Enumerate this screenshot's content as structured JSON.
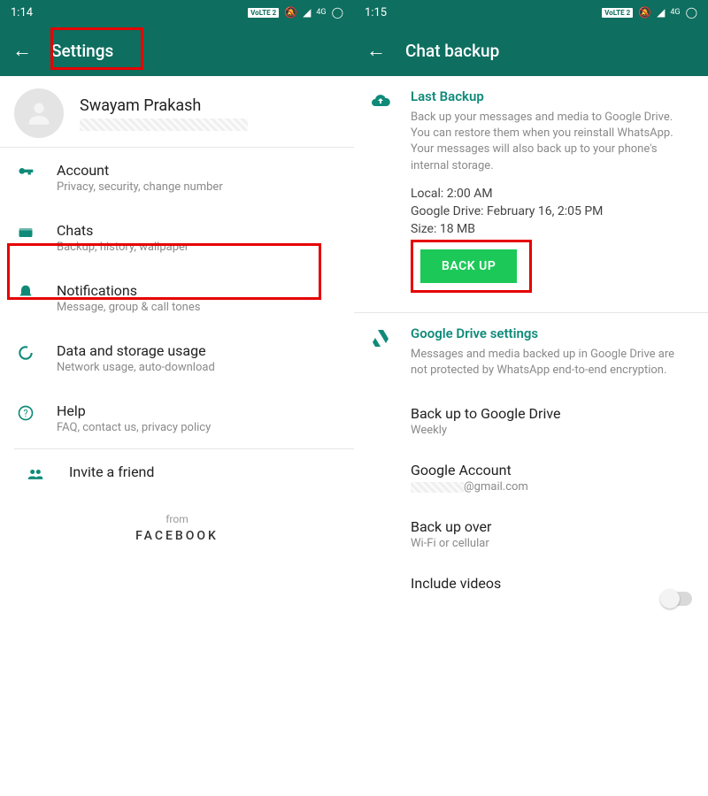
{
  "left": {
    "time": "1:14",
    "volte": "VoLTE 2",
    "title": "Settings",
    "profile_name": "Swayam Prakash",
    "rows": [
      {
        "title": "Account",
        "sub": "Privacy, security, change number"
      },
      {
        "title": "Chats",
        "sub": "Backup, history, wallpaper"
      },
      {
        "title": "Notifications",
        "sub": "Message, group & call tones"
      },
      {
        "title": "Data and storage usage",
        "sub": "Network usage, auto-download"
      },
      {
        "title": "Help",
        "sub": "FAQ, contact us, privacy policy"
      }
    ],
    "invite": "Invite a friend",
    "from": "from",
    "facebook": "FACEBOOK"
  },
  "right": {
    "time": "1:15",
    "volte": "VoLTE 2",
    "title": "Chat backup",
    "last_backup": {
      "heading": "Last Backup",
      "desc": "Back up your messages and media to Google Drive. You can restore them when you reinstall WhatsApp. Your messages will also back up to your phone's internal storage.",
      "local": "Local: 2:00 AM",
      "gdrive": "Google Drive: February 16, 2:05 PM",
      "size": "Size: 18 MB",
      "button": "BACK UP"
    },
    "gdrive_settings": {
      "heading": "Google Drive settings",
      "desc": "Messages and media backed up in Google Drive are not protected by WhatsApp end-to-end encryption."
    },
    "subrows": [
      {
        "title": "Back up to Google Drive",
        "sub": "Weekly"
      },
      {
        "title": "Google Account",
        "sub": "@gmail.com"
      },
      {
        "title": "Back up over",
        "sub": "Wi-Fi or cellular"
      },
      {
        "title": "Include videos",
        "sub": ""
      }
    ]
  }
}
